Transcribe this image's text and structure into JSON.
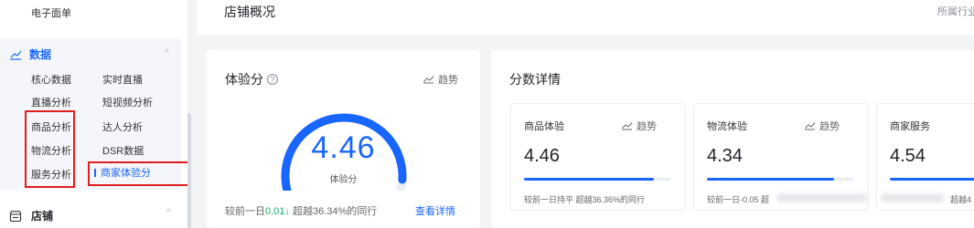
{
  "sidebar": {
    "top_item": "电子面单",
    "data_group": {
      "title": "数据",
      "items": [
        "核心数据",
        "实时直播",
        "直播分析",
        "短视频分析",
        "商品分析",
        "达人分析",
        "物流分析",
        "DSR数据",
        "服务分析",
        "商家体验分"
      ],
      "active_item": "商家体验分"
    },
    "store_group": {
      "title": "店铺"
    }
  },
  "header": {
    "title": "店铺概况",
    "right_text": "所属行业"
  },
  "experience_card": {
    "title": "体验分",
    "help": "?",
    "trend_label": "趋势",
    "score": "4.46",
    "score_label": "体验分",
    "gauge_fraction": 0.89,
    "compare_prefix": "较前一日",
    "compare_delta": "0.01",
    "compare_arrow": "↓",
    "compare_suffix": "超越36.34%的同行",
    "detail_link": "查看详情"
  },
  "score_detail": {
    "title": "分数详情",
    "trend_label": "趋势",
    "items": [
      {
        "name": "商品体验",
        "value": "4.46",
        "fraction": 0.89,
        "footer": "较前一日持平 超越36.36%的同行"
      },
      {
        "name": "物流体验",
        "value": "4.34",
        "fraction": 0.87,
        "footer": "较前一日-0.05 超"
      },
      {
        "name": "商家服务",
        "value": "4.54",
        "fraction": 0.91,
        "footer": "超越4"
      }
    ]
  },
  "colors": {
    "accent": "#1966ff",
    "highlight_box": "#e01e1e",
    "green": "#19b26b"
  }
}
